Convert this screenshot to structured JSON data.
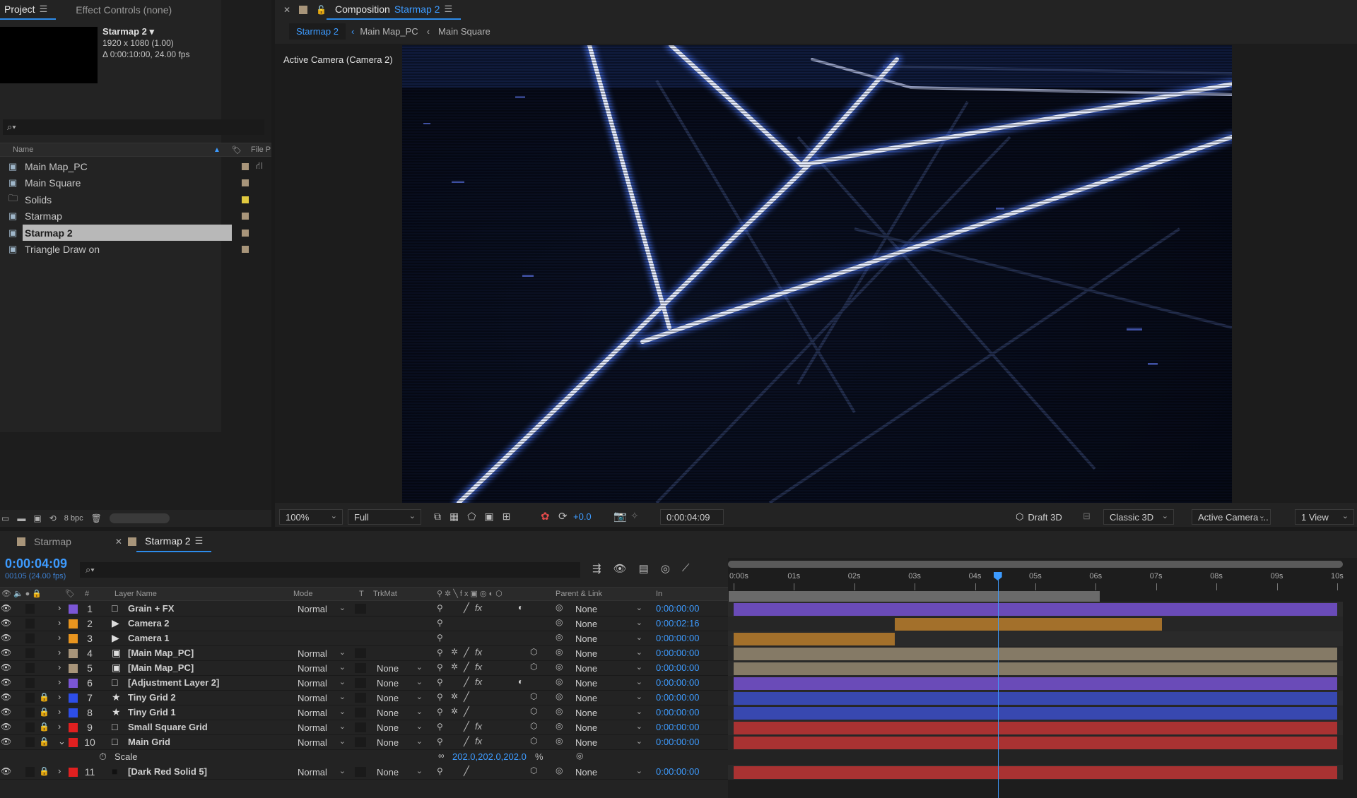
{
  "project_panel": {
    "tab_project": "Project",
    "tab_effect_controls": "Effect Controls (none)",
    "preview_name": "Starmap 2 ▾",
    "preview_dims": "1920 x 1080 (1.00)",
    "preview_duration": "Δ 0:00:10:00, 24.00 fps",
    "col_name": "Name",
    "col_file": "File P",
    "items": [
      {
        "label": "Main Map_PC",
        "type": "comp",
        "color": "#a8957a"
      },
      {
        "label": "Main Square",
        "type": "comp",
        "color": "#a8957a"
      },
      {
        "label": "Solids",
        "type": "folder",
        "color": "#e0c93f"
      },
      {
        "label": "Starmap",
        "type": "comp",
        "color": "#a8957a"
      },
      {
        "label": "Starmap 2",
        "type": "comp",
        "color": "#a8957a",
        "selected": true
      },
      {
        "label": "Triangle Draw on",
        "type": "comp",
        "color": "#a8957a"
      }
    ],
    "bpc": "8 bpc"
  },
  "composition_panel": {
    "tab_label": "Composition",
    "tab_comp_name": "Starmap 2",
    "breadcrumbs": [
      "Starmap 2",
      "Main Map_PC",
      "Main Square"
    ],
    "camera_label": "Active Camera (Camera 2)",
    "zoom": "100%",
    "resolution": "Full",
    "exposure": "+0.0",
    "timecode": "0:00:04:09",
    "draft3d": "Draft 3D",
    "renderer": "Classic 3D",
    "view_camera": "Active Camera ...",
    "view_layout": "1 View"
  },
  "timeline": {
    "tab_starmap": "Starmap",
    "tab_starmap2": "Starmap 2",
    "timecode": "0:00:04:09",
    "frame_info": "00105 (24.00 fps)",
    "headers": {
      "num": "#",
      "layer_name": "Layer Name",
      "mode": "Mode",
      "t": "T",
      "trkmat": "TrkMat",
      "parent": "Parent & Link",
      "in": "In"
    },
    "ruler": [
      "0:00s",
      "01s",
      "02s",
      "03s",
      "04s",
      "05s",
      "06s",
      "07s",
      "08s",
      "09s",
      "10s"
    ],
    "current_time_seconds": 4.375,
    "work_area_end_seconds": 6.05,
    "layers": [
      {
        "num": "1",
        "name": "Grain + FX",
        "type": "solid",
        "label_color": "#7b56d6",
        "mode": "Normal",
        "trkmat": "",
        "parent": "None",
        "in": "0:00:00:00",
        "start": 0,
        "end": 10,
        "bar_color": "#6a4bb8"
      },
      {
        "num": "2",
        "name": "Camera 2",
        "type": "camera",
        "label_color": "#e8951f",
        "mode": "",
        "trkmat": "",
        "parent": "None",
        "in": "0:00:02:16",
        "start": 2.67,
        "end": 7.1,
        "bar_color": "#a3702b"
      },
      {
        "num": "3",
        "name": "Camera 1",
        "type": "camera",
        "label_color": "#e8951f",
        "mode": "",
        "trkmat": "",
        "parent": "None",
        "in": "0:00:00:00",
        "start": 0,
        "end": 2.67,
        "bar_color": "#a3702b"
      },
      {
        "num": "4",
        "name": "[Main Map_PC]",
        "type": "comp",
        "label_color": "#a8957a",
        "mode": "Normal",
        "trkmat": "",
        "parent": "None",
        "in": "0:00:00:00",
        "start": 0,
        "end": 10,
        "bar_color": "#857a66"
      },
      {
        "num": "5",
        "name": "[Main Map_PC]",
        "type": "comp",
        "label_color": "#a8957a",
        "mode": "Normal",
        "trkmat": "None",
        "parent": "None",
        "in": "0:00:00:00",
        "start": 0,
        "end": 10,
        "bar_color": "#857a66"
      },
      {
        "num": "6",
        "name": "[Adjustment Layer 2]",
        "type": "solid",
        "label_color": "#7b56d6",
        "mode": "Normal",
        "trkmat": "None",
        "parent": "None",
        "in": "0:00:00:00",
        "start": 0,
        "end": 10,
        "bar_color": "#6a4bb8"
      },
      {
        "num": "7",
        "name": "Tiny Grid 2",
        "type": "shape",
        "label_color": "#2d4ee8",
        "mode": "Normal",
        "trkmat": "None",
        "parent": "None",
        "in": "0:00:00:00",
        "start": 0,
        "end": 10,
        "bar_color": "#3848b0",
        "locked": true
      },
      {
        "num": "8",
        "name": "Tiny Grid 1",
        "type": "shape",
        "label_color": "#2d4ee8",
        "mode": "Normal",
        "trkmat": "None",
        "parent": "None",
        "in": "0:00:00:00",
        "start": 0,
        "end": 10,
        "bar_color": "#3848b0",
        "locked": true
      },
      {
        "num": "9",
        "name": "Small Square Grid",
        "type": "solid",
        "label_color": "#e02020",
        "mode": "Normal",
        "trkmat": "None",
        "parent": "None",
        "in": "0:00:00:00",
        "start": 0,
        "end": 10,
        "bar_color": "#a93232",
        "locked": true
      },
      {
        "num": "10",
        "name": "Main Grid",
        "type": "solid",
        "label_color": "#e02020",
        "mode": "Normal",
        "trkmat": "None",
        "parent": "None",
        "in": "0:00:00:00",
        "start": 0,
        "end": 10,
        "bar_color": "#a93232",
        "locked": true,
        "expanded": true
      },
      {
        "num": "11",
        "name": "[Dark Red Solid 5]",
        "type": "solid-dark",
        "label_color": "#e02020",
        "mode": "Normal",
        "trkmat": "None",
        "parent": "None",
        "in": "0:00:00:00",
        "start": 0,
        "end": 10,
        "bar_color": "#a93232",
        "locked": true
      }
    ],
    "property": {
      "name": "Scale",
      "value": "202.0,202.0,202.0",
      "unit": "%"
    }
  }
}
